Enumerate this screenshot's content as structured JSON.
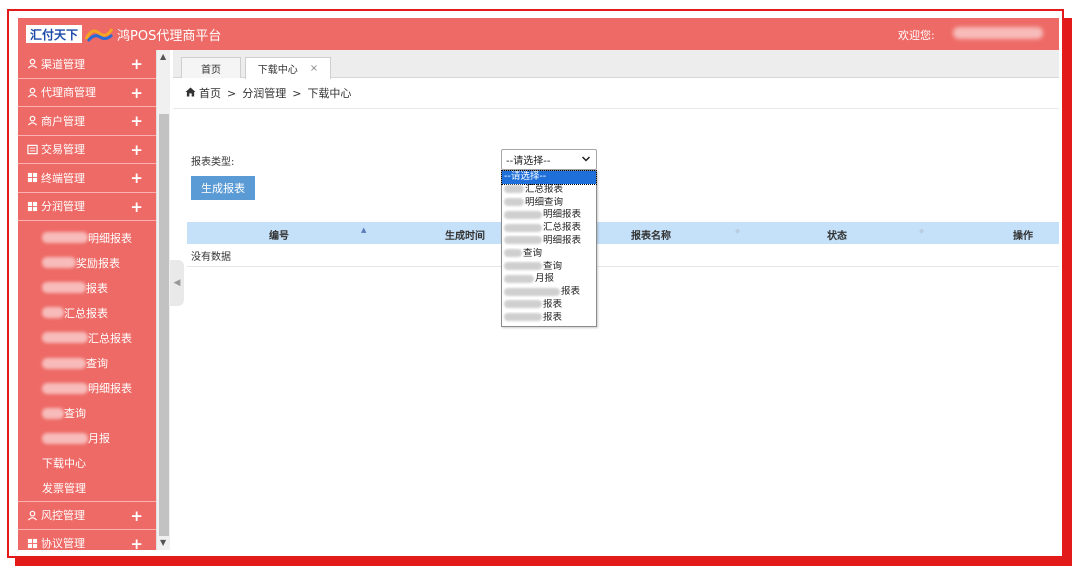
{
  "header": {
    "brand_name": "汇付天下",
    "title": "鸿POS代理商平台",
    "welcome": "欢迎您:"
  },
  "sidebar": {
    "groups": [
      {
        "label": "渠道管理",
        "icon": "user-icon",
        "expanded": false
      },
      {
        "label": "代理商管理",
        "icon": "user-icon",
        "expanded": false
      },
      {
        "label": "商户管理",
        "icon": "user-icon",
        "expanded": false
      },
      {
        "label": "交易管理",
        "icon": "list-icon",
        "expanded": false
      },
      {
        "label": "终端管理",
        "icon": "grid-icon",
        "expanded": false
      },
      {
        "label": "分润管理",
        "icon": "grid-icon",
        "expanded": true
      }
    ],
    "sub_items": [
      {
        "label": "明细报表"
      },
      {
        "label": "奖励报表"
      },
      {
        "label": "报表"
      },
      {
        "label": "汇总报表"
      },
      {
        "label": "汇总报表"
      },
      {
        "label": "查询"
      },
      {
        "label": "明细报表"
      },
      {
        "label": "查询"
      },
      {
        "label": "月报"
      },
      {
        "label": "下载中心"
      },
      {
        "label": "发票管理"
      }
    ],
    "bottom_groups": [
      {
        "label": "风控管理",
        "icon": "user-icon"
      },
      {
        "label": "协议管理",
        "icon": "grid-icon"
      }
    ],
    "plus_symbol": "+"
  },
  "tabs": [
    {
      "label": "首页",
      "active": false
    },
    {
      "label": "下载中心",
      "active": true,
      "close": "×"
    }
  ],
  "breadcrumb": {
    "home": "首页",
    "sep": ">",
    "level1": "分润管理",
    "level2": "下载中心"
  },
  "form": {
    "report_type_label": "报表类型:",
    "select_value": "--请选择--",
    "generate_button": "生成报表"
  },
  "table": {
    "columns": [
      "编号",
      "生成时间",
      "报表名称",
      "状态",
      "操作"
    ],
    "empty_text": "没有数据"
  },
  "dropdown_options": [
    "--请选择--",
    "汇总报表",
    "明细查询",
    "明细报表",
    "汇总报表",
    "明细报表",
    "查询",
    "查询",
    "月报",
    "报表",
    "报表",
    "报表"
  ],
  "colors": {
    "brand_red": "#ee6a66",
    "frame_red": "#e21a1a",
    "table_header_blue": "#c5e1f9",
    "button_blue": "#5b9bd5"
  }
}
